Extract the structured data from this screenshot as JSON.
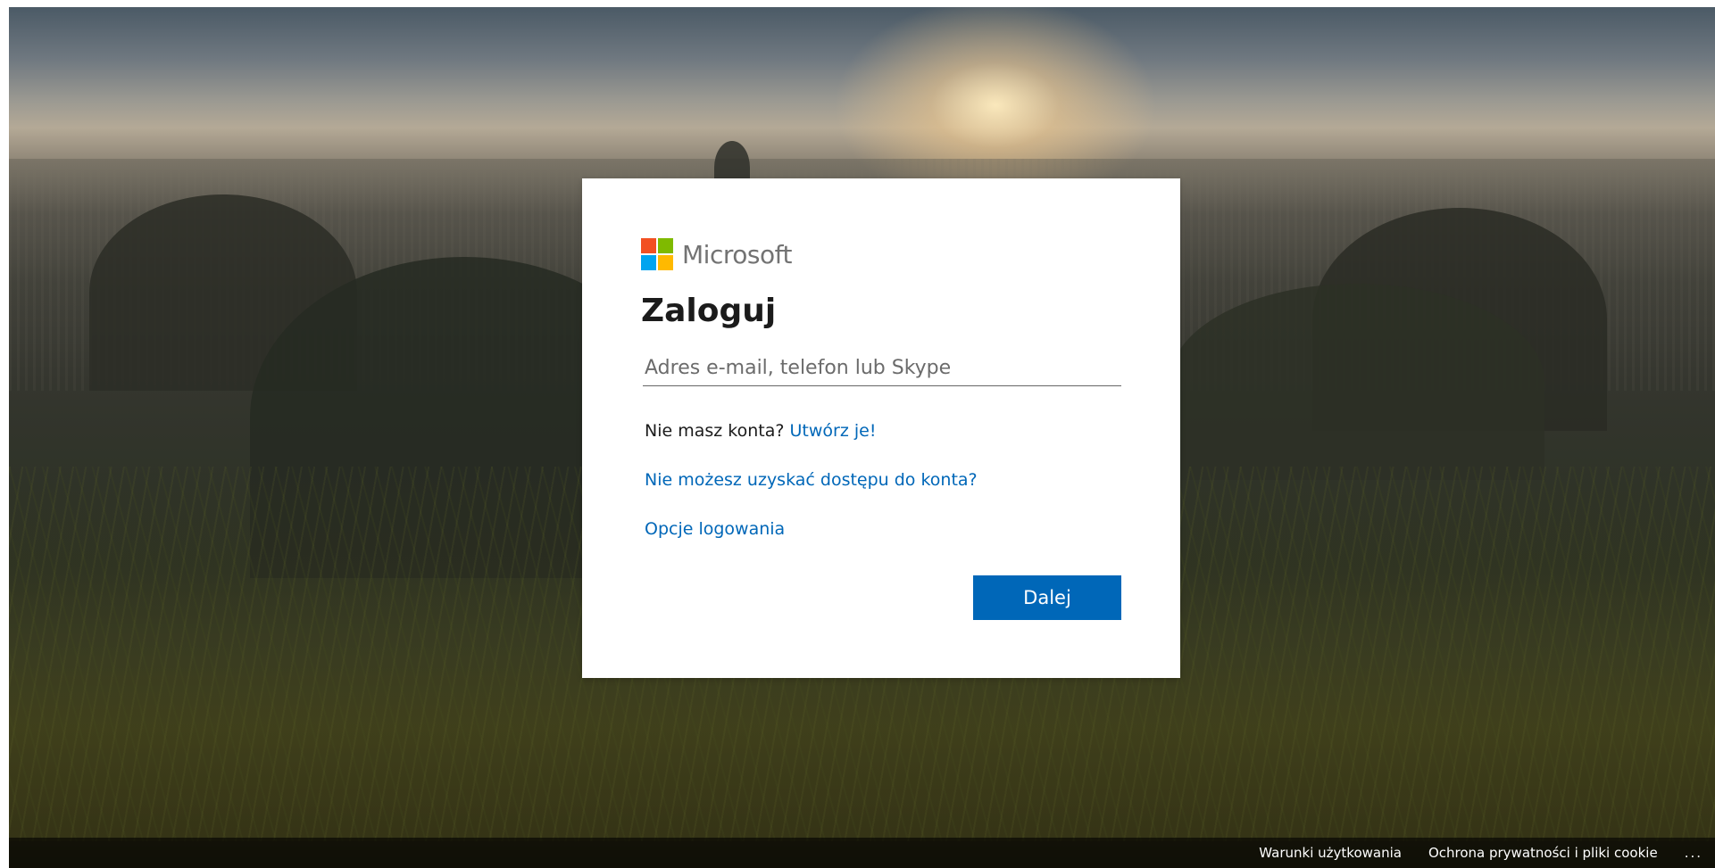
{
  "brand": {
    "name": "Microsoft",
    "colors": {
      "red": "#f25022",
      "green": "#7fba00",
      "blue": "#00a4ef",
      "yellow": "#ffb900",
      "accent": "#0067b8"
    }
  },
  "signin": {
    "title": "Zaloguj",
    "email_placeholder": "Adres e-mail, telefon lub Skype",
    "email_value": "",
    "no_account_text": "Nie masz konta?",
    "create_link": "Utwórz je!",
    "cant_access_link": "Nie możesz uzyskać dostępu do konta?",
    "signin_options_link": "Opcje logowania",
    "next_button": "Dalej"
  },
  "footer": {
    "terms": "Warunki użytkowania",
    "privacy": "Ochrona prywatności i pliki cookie",
    "more": "..."
  }
}
